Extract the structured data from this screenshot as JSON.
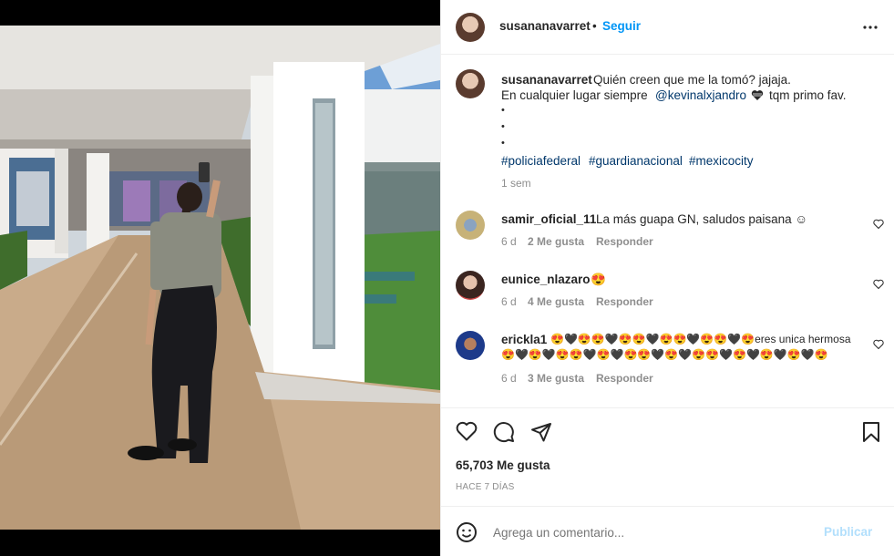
{
  "post": {
    "author": "susananavarret",
    "follow_sep": "•",
    "follow_label": "Seguir",
    "caption": {
      "username": "susananavarret",
      "line1": "Quién creen que me la tomó? jajaja.",
      "line2_pre": "En cualquier lugar siempre",
      "mention": "@kevinalxjandro",
      "line2_post": "tqm primo fav.",
      "dots": [
        "•",
        "•",
        "•"
      ],
      "hashtags": [
        "#policiafederal",
        "#guardianacional",
        "#mexicocity"
      ],
      "time": "1 sem"
    },
    "comments": [
      {
        "username": "samir_oficial_11",
        "text": "La más guapa GN, saludos paisana ☺",
        "time": "6 d",
        "likes": "2 Me gusta",
        "reply": "Responder"
      },
      {
        "username": "eunice_nlazaro",
        "text": "😍",
        "time": "6 d",
        "likes": "4 Me gusta",
        "reply": "Responder"
      },
      {
        "username": "ericklа1",
        "text": "😍🖤😍😍🖤😍😍🖤😍😍🖤😍😍🖤😍eres unica hermosa",
        "text2": "😍🖤😍🖤😍😍🖤😍🖤😍😍🖤😍🖤😍😍🖤😍🖤😍🖤😍🖤😍",
        "time": "6 d",
        "likes": "3 Me gusta",
        "reply": "Responder"
      }
    ],
    "likes_count": "65,703 Me gusta",
    "posted_ago": "HACE 7 DÍAS",
    "comment_placeholder": "Agrega un comentario...",
    "publish_label": "Publicar"
  },
  "icons": {
    "more": "more-options-icon",
    "like": "heart-icon",
    "comment": "comment-icon",
    "share": "share-icon",
    "save": "bookmark-icon",
    "emoji": "emoji-icon"
  },
  "colors": {
    "link": "#00376b",
    "follow": "#0095f6",
    "publish_disabled": "#b2dffc",
    "muted": "#8e8e8e"
  }
}
